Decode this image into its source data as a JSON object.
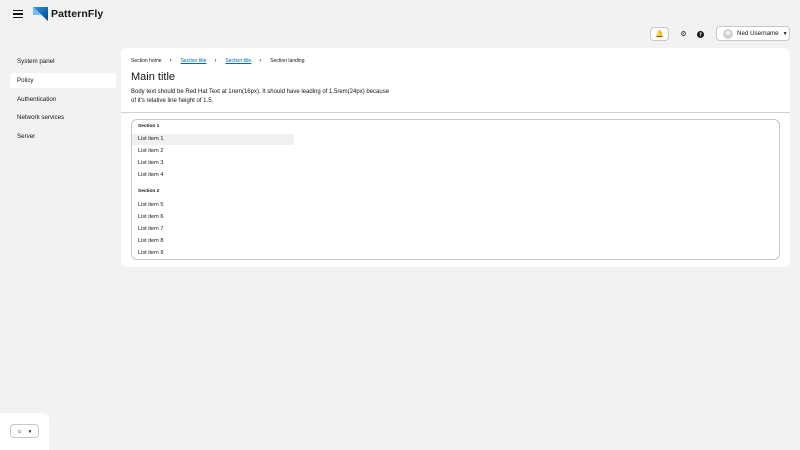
{
  "masthead": {
    "brand": "PatternFly",
    "user_name": "Ned Username"
  },
  "sidebar": {
    "items": [
      {
        "label": "System panel",
        "active": false
      },
      {
        "label": "Policy",
        "active": true
      },
      {
        "label": "Authentication",
        "active": false
      },
      {
        "label": "Network services",
        "active": false
      },
      {
        "label": "Server",
        "active": false
      }
    ]
  },
  "breadcrumb": {
    "items": [
      "Section home",
      "Section title",
      "Section title",
      "Section landing"
    ]
  },
  "main": {
    "title": "Main title",
    "body_line1": "Body text should be Red Hat Text at 1rem(16px). It should have leading of 1.5rem(24px) because",
    "body_line2": "of it's relative line height of 1.5."
  },
  "menu": {
    "sections": [
      {
        "title": "Section 1",
        "items": [
          "List item 1",
          "List item 2",
          "List item 3",
          "List item 4"
        ]
      },
      {
        "title": "Section 2",
        "items": [
          "List item 5",
          "List item 6",
          "List item 7",
          "List item 8",
          "List item 9"
        ]
      }
    ],
    "focused_item": "List item 1"
  },
  "icons": {
    "menu": "hamburger-icon",
    "notifications": "bell-icon",
    "settings": "gear-icon",
    "help": "help-icon",
    "theme": "sun-icon"
  },
  "colors": {
    "link": "#0066cc",
    "page_bg": "#f2f2f2",
    "surface": "#ffffff",
    "border": "#c7c7c7",
    "text": "#151515"
  }
}
